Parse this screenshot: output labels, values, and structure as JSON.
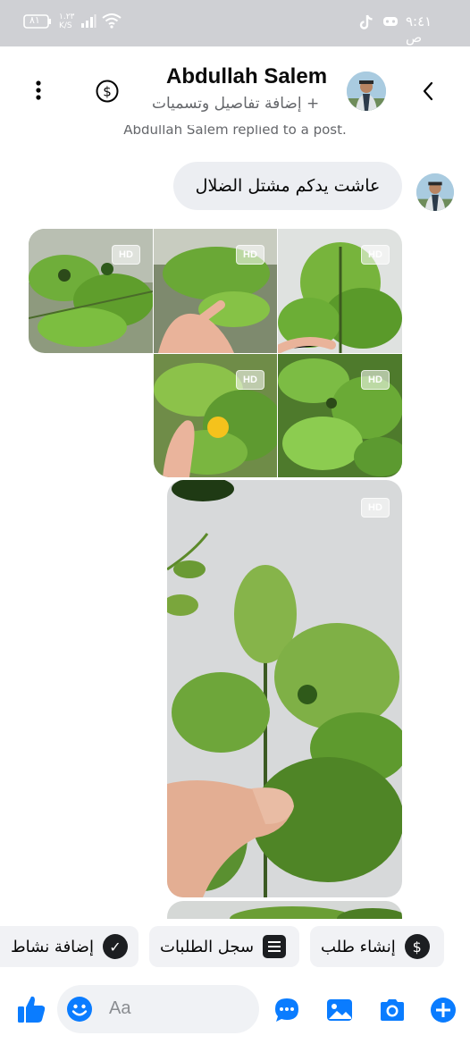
{
  "status_bar": {
    "time": "٩:٤١ ص",
    "battery": "٨١",
    "network_speed": "١.٢٣\nK/S",
    "icons": [
      "tiktok-icon",
      "game-icon",
      "wifi-icon",
      "signal-icon",
      "battery-icon"
    ]
  },
  "header": {
    "contact_name": "Abdullah Salem",
    "subtitle": "+ إضافة تفاصيل وتسميات",
    "icons": [
      "back-chevron-icon",
      "dollar-icon",
      "more-vertical-icon"
    ]
  },
  "conversation": {
    "replied_note": "Abdullah Salem replied to a post.",
    "message_text": "عاشت يدكم مشتل الضلال",
    "photo_badge": "HD"
  },
  "quick_actions": {
    "create_request": "إنشاء طلب",
    "request_log": "سجل الطلبات",
    "add_activity": "إضافة نشاط"
  },
  "composer": {
    "placeholder": "Aa",
    "icons": [
      "add-icon",
      "camera-icon",
      "gallery-icon",
      "chat-bubble-icon",
      "emoji-icon",
      "like-icon"
    ]
  },
  "colors": {
    "accent": "#0a7cff",
    "status_bar_bg": "#cfd0d4",
    "bubble_bg": "#eceef2",
    "chip_bg": "#f1f2f5"
  }
}
